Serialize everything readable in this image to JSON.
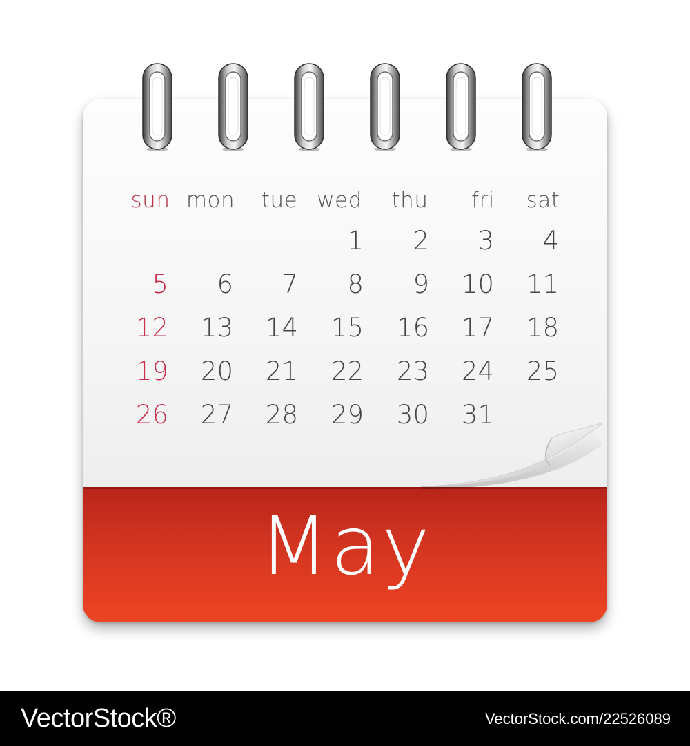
{
  "calendar": {
    "month": "May",
    "weekdays": [
      "sun",
      "mon",
      "tue",
      "wed",
      "thu",
      "fri",
      "sat"
    ],
    "weeks": [
      [
        "",
        "",
        "",
        "1",
        "2",
        "3",
        "4"
      ],
      [
        "5",
        "6",
        "7",
        "8",
        "9",
        "10",
        "11"
      ],
      [
        "12",
        "13",
        "14",
        "15",
        "16",
        "17",
        "18"
      ],
      [
        "19",
        "20",
        "21",
        "22",
        "23",
        "24",
        "25"
      ],
      [
        "26",
        "27",
        "28",
        "29",
        "30",
        "31",
        ""
      ]
    ],
    "ring_count": 6
  },
  "colors": {
    "banner": "#d9381f",
    "sunday_text": "#c6304a",
    "date_text": "#454545",
    "page": "#f4f4f4",
    "ring": "#8a8a8a"
  },
  "icons": {
    "rings": "spiral-binding-ring",
    "curl": "page-curl"
  },
  "watermark": {
    "logo": "VectorStock®",
    "id": "VectorStock.com/22526089"
  }
}
